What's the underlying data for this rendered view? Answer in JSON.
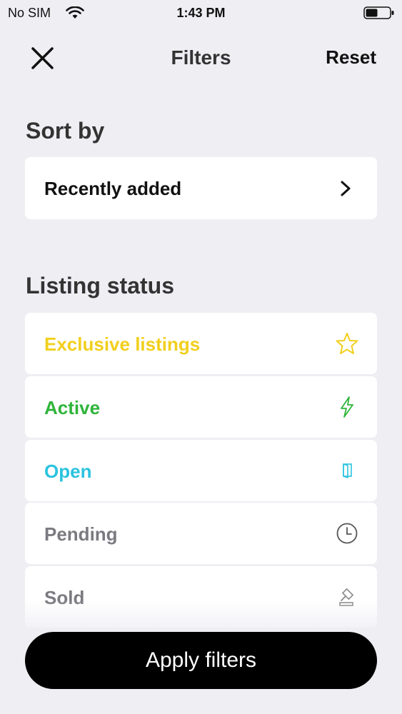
{
  "status_bar": {
    "carrier": "No SIM",
    "time": "1:43 PM"
  },
  "header": {
    "title": "Filters",
    "reset_label": "Reset",
    "close_icon": "close-icon"
  },
  "sort": {
    "heading": "Sort by",
    "selected": "Recently added",
    "chevron_icon": "chevron-right-icon"
  },
  "listing_status": {
    "heading": "Listing status",
    "items": [
      {
        "label": "Exclusive listings",
        "icon": "star-icon",
        "color": "#f2cf1d"
      },
      {
        "label": "Active",
        "icon": "lightning-icon",
        "color": "#2fb43a"
      },
      {
        "label": "Open",
        "icon": "door-icon",
        "color": "#2bc3df"
      },
      {
        "label": "Pending",
        "icon": "clock-icon",
        "color": "#7a7a80"
      },
      {
        "label": "Sold",
        "icon": "gavel-icon",
        "color": "#7a7a80"
      }
    ]
  },
  "apply_label": "Apply filters"
}
